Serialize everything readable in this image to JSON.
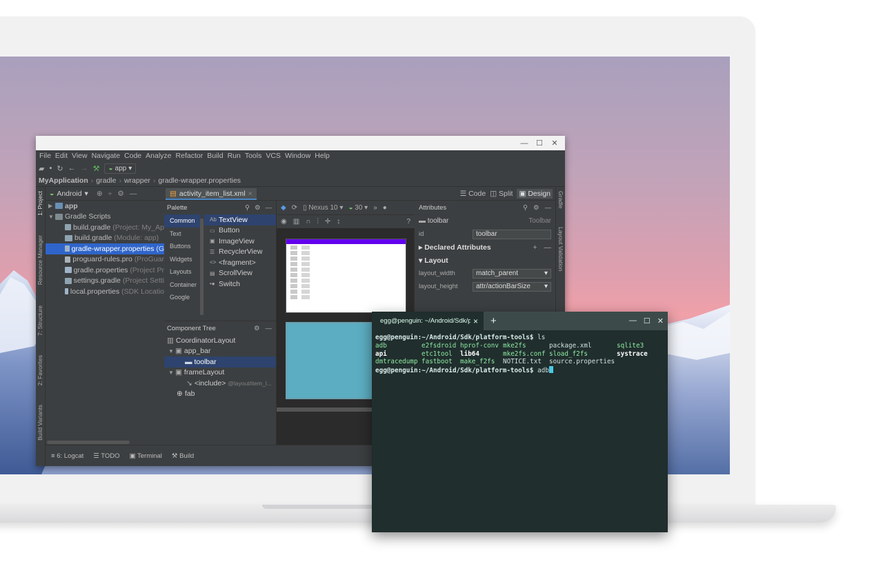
{
  "ide": {
    "window_controls": {
      "minimize": "—",
      "maximize": "☐",
      "close": "✕"
    },
    "menu": [
      "File",
      "Edit",
      "View",
      "Navigate",
      "Code",
      "Analyze",
      "Refactor",
      "Build",
      "Run",
      "Tools",
      "VCS",
      "Window",
      "Help"
    ],
    "run_config": "app",
    "breadcrumb": [
      "MyApplication",
      "gradle",
      "wrapper",
      "gradle-wrapper.properties"
    ],
    "left_tool_tabs": [
      "1: Project",
      "Resource Manager",
      "7: Structure",
      "2: Favorites",
      "Build Variants"
    ],
    "right_tool_tabs": [
      "Gradle",
      "Layout Validation"
    ],
    "project_view": "Android",
    "tree": [
      {
        "label": "app",
        "dim": ""
      },
      {
        "label": "Gradle Scripts",
        "dim": ""
      },
      {
        "label": "build.gradle",
        "dim": "(Project: My_Ap"
      },
      {
        "label": "build.gradle",
        "dim": "(Module: app)"
      },
      {
        "label": "gradle-wrapper.properties",
        "dim": "(G"
      },
      {
        "label": "proguard-rules.pro",
        "dim": "(ProGuar"
      },
      {
        "label": "gradle.properties",
        "dim": "(Project Pr"
      },
      {
        "label": "settings.gradle",
        "dim": "(Project Setti"
      },
      {
        "label": "local.properties",
        "dim": "(SDK Locatio"
      }
    ],
    "file_tab": "activity_item_list.xml",
    "view_modes": {
      "code": "Code",
      "split": "Split",
      "design": "Design"
    },
    "palette": {
      "title": "Palette",
      "categories": [
        "Common",
        "Text",
        "Buttons",
        "Widgets",
        "Layouts",
        "Container",
        "Google"
      ],
      "items": [
        {
          "icon": "Ab",
          "label": "TextView"
        },
        {
          "icon": "▭",
          "label": "Button"
        },
        {
          "icon": "▣",
          "label": "ImageView"
        },
        {
          "icon": "☰",
          "label": "RecyclerView"
        },
        {
          "icon": "<>",
          "label": "<fragment>"
        },
        {
          "icon": "▤",
          "label": "ScrollView"
        },
        {
          "icon": "•●",
          "label": "Switch"
        }
      ]
    },
    "canvas_toolbar": {
      "device": "Nexus 10",
      "api": "30"
    },
    "component_tree": {
      "title": "Component Tree",
      "rows": [
        {
          "label": "CoordinatorLayout",
          "dim": ""
        },
        {
          "label": "app_bar",
          "dim": ""
        },
        {
          "label": "toolbar",
          "dim": ""
        },
        {
          "label": "frameLayout",
          "dim": ""
        },
        {
          "label": "<include>",
          "dim": "@layout/item_l..."
        },
        {
          "label": "fab",
          "dim": ""
        }
      ]
    },
    "attributes": {
      "title": "Attributes",
      "component": "toolbar",
      "component_type": "Toolbar",
      "id_label": "id",
      "id_value": "toolbar",
      "declared": "Declared Attributes",
      "layout": "Layout",
      "layout_width_label": "layout_width",
      "layout_width_value": "match_parent",
      "layout_height_label": "layout_height",
      "layout_height_value": "attr/actionBarSize"
    },
    "bottom_tabs": [
      "6: Logcat",
      "TODO",
      "Terminal",
      "Build"
    ]
  },
  "terminal": {
    "tab_title": "egg@penguin: ~/Android/Sdk/platform-",
    "close": "×",
    "new_tab": "+",
    "prompt_user": "egg@penguin",
    "prompt_path": "~/Android/Sdk/platform-tools",
    "command1": "ls",
    "ls_rows": [
      [
        "adb",
        "e2fsdroid",
        "hprof-conv",
        "mke2fs",
        "package.xml",
        "sqlite3"
      ],
      [
        "api",
        "etc1tool",
        "lib64",
        "mke2fs.conf",
        "sload_f2fs",
        "systrace"
      ],
      [
        "dmtracedump",
        "fastboot",
        "make_f2fs",
        "NOTICE.txt",
        "source.properties",
        ""
      ]
    ],
    "command2": "adb",
    "colors": {
      "background": "#202e2d",
      "dir": "#6ed3e0",
      "exec": "#8ee8a2",
      "cursor": "#4ac9e5"
    }
  }
}
